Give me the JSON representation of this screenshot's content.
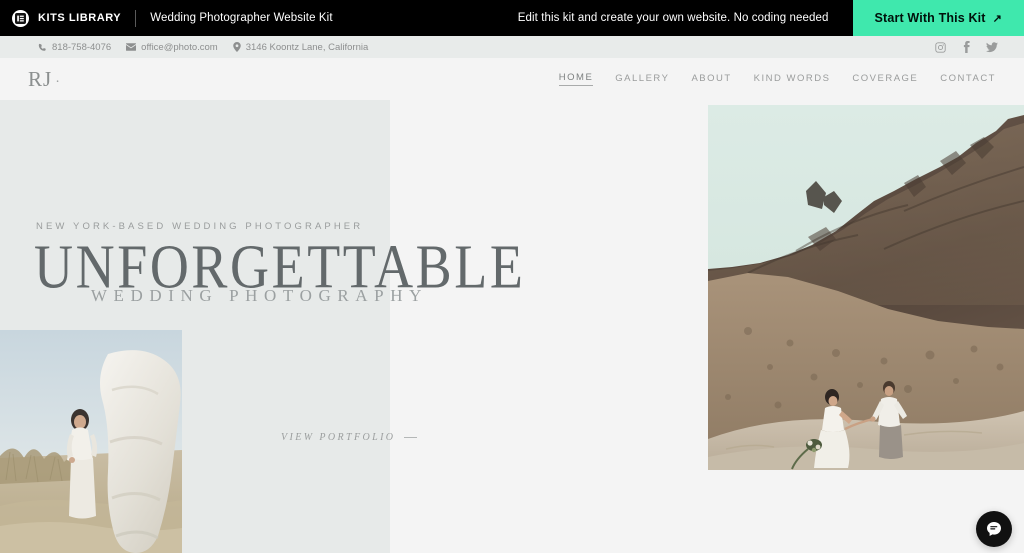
{
  "topbar": {
    "logo_icon": "kits-library-logo-icon",
    "brand": "KITS LIBRARY",
    "kit_title": "Wedding Photographer Website Kit",
    "promo_note": "Edit this kit and create your own website. No coding needed",
    "cta_label": "Start With This Kit",
    "cta_arrow": "↗",
    "cta_color": "#3fe8ad",
    "background_color": "#000000"
  },
  "contactbar": {
    "background_color": "#e8ebea",
    "phone": "818-758-4076",
    "email": "office@photo.com",
    "address": "3146 Koontz Lane, California",
    "social": [
      {
        "name": "instagram-icon",
        "label": "Instagram"
      },
      {
        "name": "facebook-icon",
        "label": "Facebook"
      },
      {
        "name": "twitter-icon",
        "label": "Twitter"
      }
    ]
  },
  "site": {
    "brand_initials": "RJ",
    "brand_dot": "·",
    "nav": [
      {
        "label": "HOME",
        "active": true
      },
      {
        "label": "GALLERY",
        "active": false
      },
      {
        "label": "ABOUT",
        "active": false
      },
      {
        "label": "KIND WORDS",
        "active": false
      },
      {
        "label": "COVERAGE",
        "active": false
      },
      {
        "label": "CONTACT",
        "active": false
      }
    ]
  },
  "hero": {
    "eyebrow": "NEW YORK-BASED WEDDING PHOTOGRAPHER",
    "headline": "UNFORGETTABLE",
    "subheadline": "WEDDING PHOTOGRAPHY",
    "cta_label": "VIEW PORTFOLIO",
    "panel_color": "#e7eae9",
    "page_color": "#f4f4f4",
    "images": [
      {
        "name": "photo-bride-dunes",
        "alt": "Woman in white dress standing in dune grass with billowing fabric"
      },
      {
        "name": "photo-couple-canyon",
        "alt": "Couple walking hand in hand on a sand dune below rocky cliffs"
      }
    ]
  },
  "chat_widget": {
    "icon": "chat-bubble-icon",
    "label": "Chat"
  }
}
